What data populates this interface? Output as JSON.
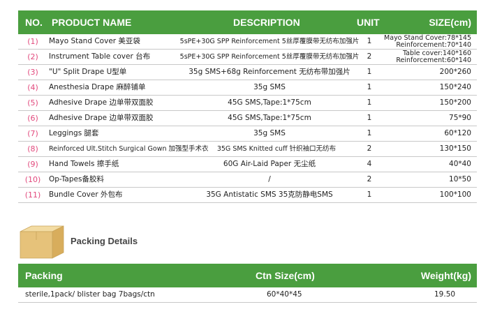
{
  "header": {
    "no": "NO.",
    "product_name": "PRODUCT NAME",
    "description": "DESCRIPTION",
    "unit": "UNIT",
    "size": "SIZE(cm)"
  },
  "rows": [
    {
      "no": "(1)",
      "name": "Mayo Stand Cover 美亚袋",
      "desc": "5sPE+30G SPP Reinforcement 5丝厚覆膜带无纺布加强片",
      "unit": "1",
      "size_line1": "Mayo Stand Cover:78*145",
      "size_line2": "Reinforcement:70*140"
    },
    {
      "no": "(2)",
      "name": "Instrument Table cover 台布",
      "desc": "5sPE+30G SPP Reinforcement 5丝厚覆膜带无纺布加强片",
      "unit": "2",
      "size_line1": "Table cover:140*160",
      "size_line2": "Reinforcement:60*140"
    },
    {
      "no": "(3)",
      "name": "\"U\" Split Drape U型单",
      "desc": "35g SMS+68g Reinforcement 无纺布带加强片",
      "unit": "1",
      "size": "200*260"
    },
    {
      "no": "(4)",
      "name": "Anesthesia Drape 麻醉铺单",
      "desc": "35g SMS",
      "unit": "1",
      "size": "150*240"
    },
    {
      "no": "(5)",
      "name": "Adhesive Drape 边单带双面胶",
      "desc": "45G SMS,Tape:1*75cm",
      "unit": "1",
      "size": "150*200"
    },
    {
      "no": "(6)",
      "name": "Adhesive Drape 边单带双面胶",
      "desc": "45G SMS,Tape:1*75cm",
      "unit": "1",
      "size": "75*90"
    },
    {
      "no": "(7)",
      "name": "Leggings 腿套",
      "desc": "35g SMS",
      "unit": "1",
      "size": "60*120"
    },
    {
      "no": "(8)",
      "name": "Reinforced Ult.Stitch Surgical Gown 加强型手术衣",
      "desc": "35G SMS Knitted cuff 针织袖口无纺布",
      "unit": "2",
      "size": "130*150"
    },
    {
      "no": "(9)",
      "name": "Hand Towels 擦手纸",
      "desc": "60G Air-Laid Paper 无尘纸",
      "unit": "4",
      "size": "40*40"
    },
    {
      "no": "(10)",
      "name": "Op-Tapes备胶料",
      "desc": "/",
      "unit": "2",
      "size": "10*50"
    },
    {
      "no": "(11)",
      "name": "Bundle Cover 外包布",
      "desc": "35G Antistatic SMS 35克防静电SMS",
      "unit": "1",
      "size": "100*100"
    }
  ],
  "packing": {
    "section_title": "Packing Details",
    "icon": "box-icon",
    "header": {
      "packing": "Packing",
      "ctn": "Ctn Size(cm)",
      "weight": "Weight(kg)"
    },
    "row": {
      "packing": "sterile,1pack/ blister bag   7bags/ctn",
      "ctn": "60*40*45",
      "weight": "19.50"
    }
  },
  "colors": {
    "header_green": "#4a9e3f",
    "row_number": "#e24a7d",
    "box": "#e6c27a"
  }
}
